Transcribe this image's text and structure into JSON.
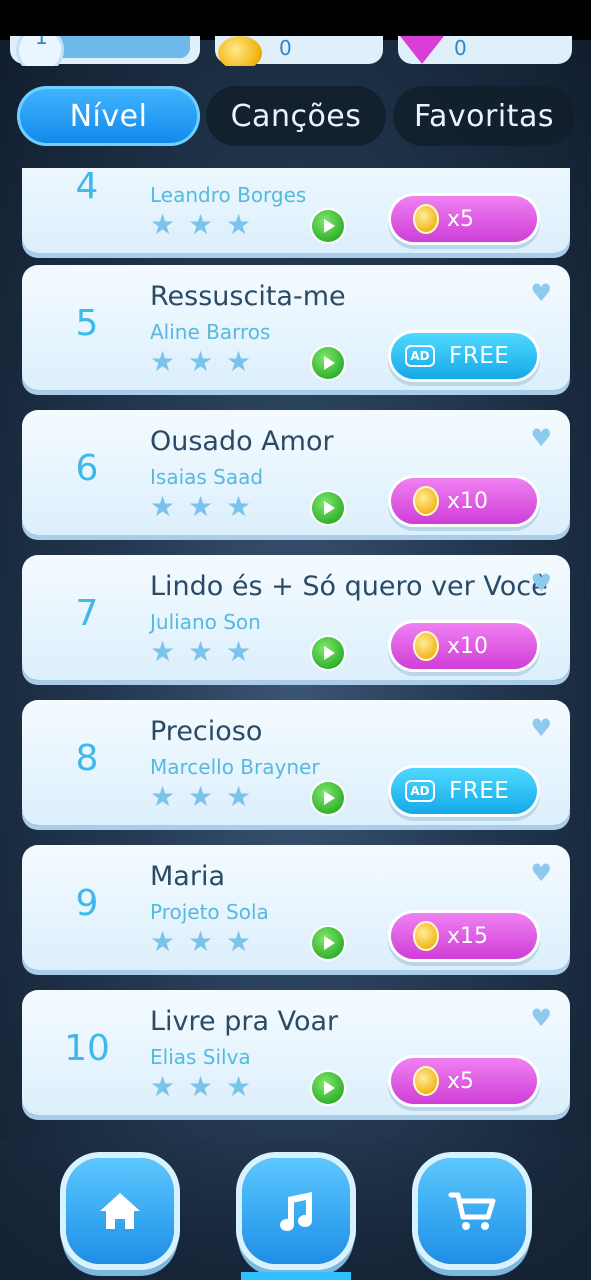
{
  "topbar": {
    "level": "1",
    "coins": "0",
    "gems": "0"
  },
  "tabs": [
    {
      "label": "Nível",
      "active": true
    },
    {
      "label": "Canções",
      "active": false
    },
    {
      "label": "Favoritas",
      "active": false
    }
  ],
  "songs": [
    {
      "number": "4",
      "title": "",
      "artist": "Leandro Borges",
      "price_type": "coin",
      "price": "x5"
    },
    {
      "number": "5",
      "title": "Ressuscita-me",
      "artist": "Aline Barros",
      "price_type": "ad",
      "price": "FREE",
      "ad_label": "AD"
    },
    {
      "number": "6",
      "title": "Ousado Amor",
      "artist": "Isaias Saad",
      "price_type": "coin",
      "price": "x10"
    },
    {
      "number": "7",
      "title": "Lindo és + Só quero ver Você",
      "artist": "Juliano Son",
      "price_type": "coin",
      "price": "x10"
    },
    {
      "number": "8",
      "title": "Precioso",
      "artist": "Marcello Brayner",
      "price_type": "ad",
      "price": "FREE",
      "ad_label": "AD"
    },
    {
      "number": "9",
      "title": "Maria",
      "artist": "Projeto Sola",
      "price_type": "coin",
      "price": "x15"
    },
    {
      "number": "10",
      "title": "Livre pra Voar",
      "artist": "Elias Silva",
      "price_type": "coin",
      "price": "x5"
    }
  ],
  "stars_per_song": 3,
  "icons": {
    "home": "home-icon",
    "music": "music-note-icon",
    "cart": "cart-icon",
    "heart": "heart-icon",
    "play": "play-icon",
    "star": "star-icon",
    "coin": "coin-icon",
    "gem": "gem-icon"
  },
  "bottom_nav": {
    "active": "music"
  },
  "colors": {
    "tab_active": "#1e9cf0",
    "coin_button": "#e05ae4",
    "ad_button": "#22b8f0",
    "number": "#3fb9ea"
  }
}
